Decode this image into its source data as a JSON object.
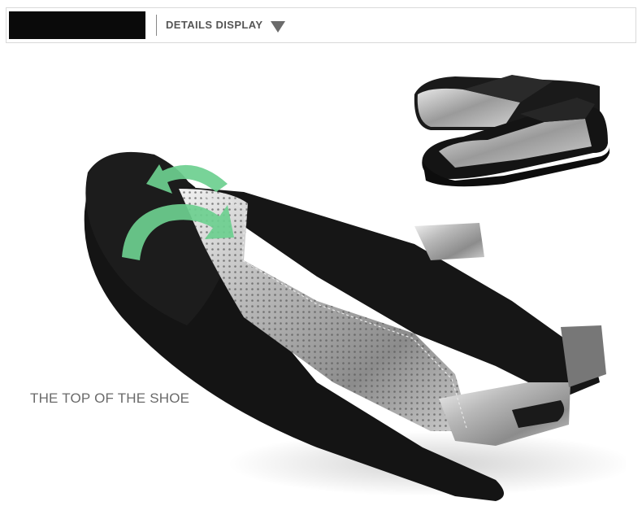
{
  "header": {
    "title": "DETAILS DISPLAY",
    "triangle_icon": "triangle-down-icon"
  },
  "caption": "THE TOP OF THE SHOE",
  "colors": {
    "accent_green": "#6dcf8f",
    "text_gray": "#6a6a6a",
    "header_text": "#555555"
  }
}
